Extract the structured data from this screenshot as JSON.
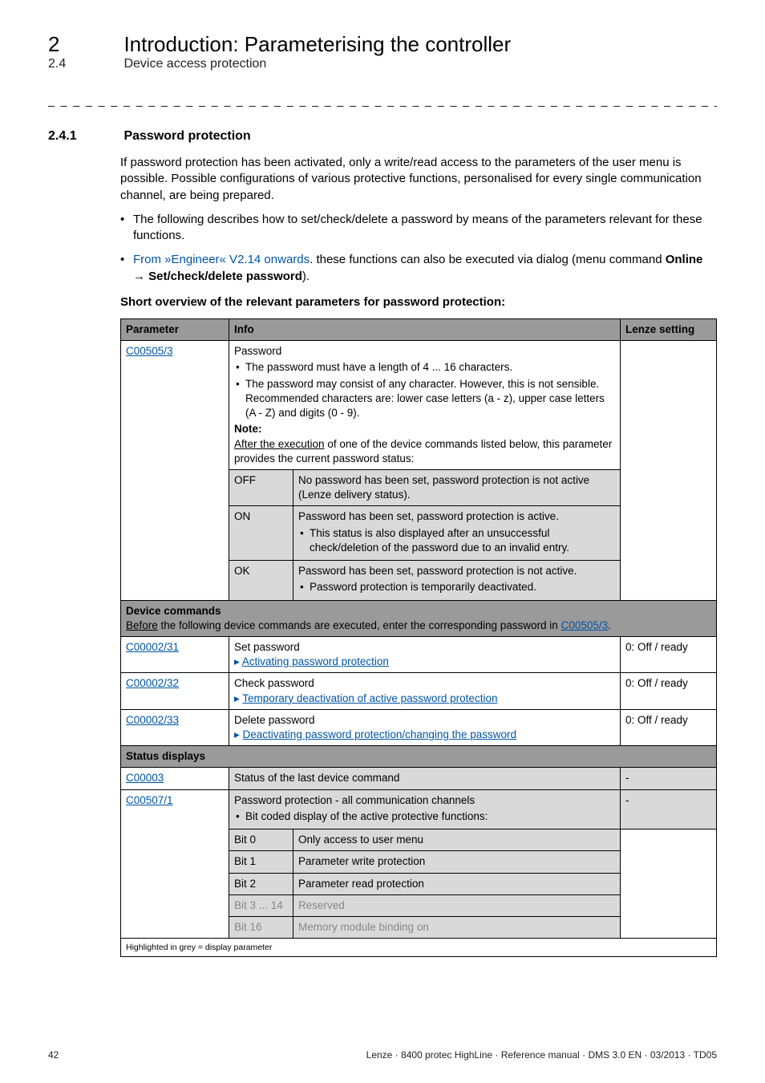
{
  "header": {
    "chapter_num": "2",
    "chapter_title": "Introduction: Parameterising the controller",
    "section_num": "2.4",
    "section_title": "Device access protection"
  },
  "h3": {
    "num": "2.4.1",
    "title": "Password protection"
  },
  "intro": {
    "p1": "If password protection has been activated, only a write/read access to the parameters of the user menu is possible. Possible configurations of various protective functions, personalised for every single communication channel, are being prepared.",
    "b1": "The following describes how to set/check/delete a password by means of the parameters relevant for these functions.",
    "b2a": "From »Engineer« V2.14 onwards",
    "b2b": ". these functions can also be executed via dialog (menu command ",
    "b2c_bold": "Online",
    "b2d_bold": "Set/check/delete password",
    "b2e": ").",
    "overview": "Short overview of the relevant parameters for password protection:"
  },
  "table": {
    "head": {
      "c1": "Parameter",
      "c2": "Info",
      "c4": "Lenze setting"
    },
    "r1": {
      "param": "C00505/3",
      "title": "Password",
      "li1": "The password must have a length of 4 ... 16 characters.",
      "li2": "The password may consist of any character. However, this is not sensible. Recommended characters are: lower case letters (a - z), upper case letters (A - Z) and digits (0 - 9).",
      "note_label": "Note:",
      "note_text_a": "After the execution",
      "note_text_b": " of one of the device commands listed below, this parameter provides the current password status:"
    },
    "r1_off": {
      "k": "OFF",
      "v": "No password has been set, password protection is not active (Lenze delivery status)."
    },
    "r1_on": {
      "k": "ON",
      "v1": "Password has been set, password protection is active.",
      "v2": "This status is also displayed after an unsuccessful check/deletion of the password due to an invalid entry."
    },
    "r1_ok": {
      "k": "OK",
      "v1": "Password has been set, password protection is not active.",
      "v2": "Password protection is temporarily deactivated."
    },
    "devcmd_title": "Device commands",
    "devcmd_sub_a": "Before",
    "devcmd_sub_b": " the following device commands are executed, enter the corresponding password in ",
    "devcmd_sub_c": "C00505/3",
    "r2": {
      "param": "C00002/31",
      "title": "Set password",
      "link": "Activating password protection",
      "lenze": "0: Off / ready"
    },
    "r3": {
      "param": "C00002/32",
      "title": "Check password",
      "link": "Temporary deactivation of active password protection",
      "lenze": "0: Off / ready"
    },
    "r4": {
      "param": "C00002/33",
      "title": "Delete password",
      "link": "Deactivating password protection/changing the password",
      "lenze": "0: Off / ready"
    },
    "status_title": "Status displays",
    "r5": {
      "param": "C00003",
      "title": "Status of the last device command",
      "lenze": "-"
    },
    "r6": {
      "param": "C00507/1",
      "title": "Password protection - all communication channels",
      "sub": "Bit coded display of the active protective functions:",
      "lenze": "-",
      "bits": {
        "b0k": "Bit 0",
        "b0v": "Only access to user menu",
        "b1k": "Bit 1",
        "b1v": "Parameter write protection",
        "b2k": "Bit 2",
        "b2v": "Parameter read protection",
        "b314k": "Bit 3 ... 14",
        "b314v": "Reserved",
        "b16k": "Bit 16",
        "b16v": "Memory module binding on"
      }
    },
    "footnote": "Highlighted in grey = display parameter"
  },
  "footer": {
    "page": "42",
    "text": "Lenze · 8400 protec HighLine · Reference manual · DMS 3.0 EN · 03/2013 · TD05"
  }
}
